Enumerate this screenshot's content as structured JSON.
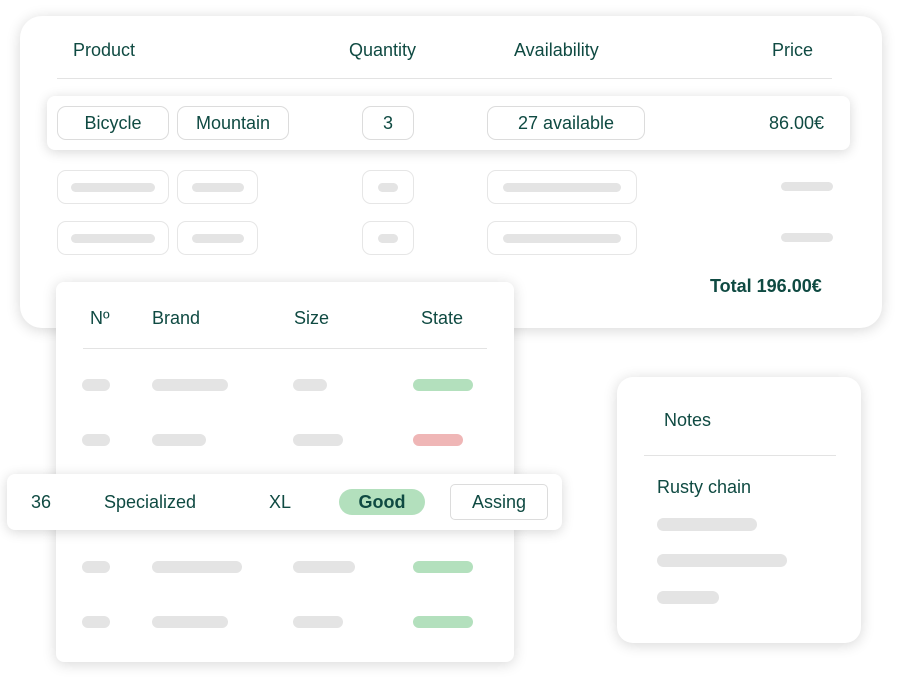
{
  "order": {
    "headers": {
      "product": "Product",
      "quantity": "Quantity",
      "availability": "Availability",
      "price": "Price"
    },
    "row": {
      "product_tag": "Bicycle",
      "type_tag": "Mountain",
      "quantity": "3",
      "availability": "27 available",
      "price": "86.00€"
    },
    "total": "Total 196.00€"
  },
  "inventory": {
    "headers": {
      "number": "Nº",
      "brand": "Brand",
      "size": "Size",
      "state": "State"
    },
    "selected_row": {
      "number": "36",
      "brand": "Specialized",
      "size": "XL",
      "state": "Good",
      "assign_label": "Assing"
    },
    "state_colors": {
      "good": "#b3e0bd",
      "bad": "#efb6b6"
    }
  },
  "notes": {
    "title": "Notes",
    "first_note": "Rusty chain"
  }
}
